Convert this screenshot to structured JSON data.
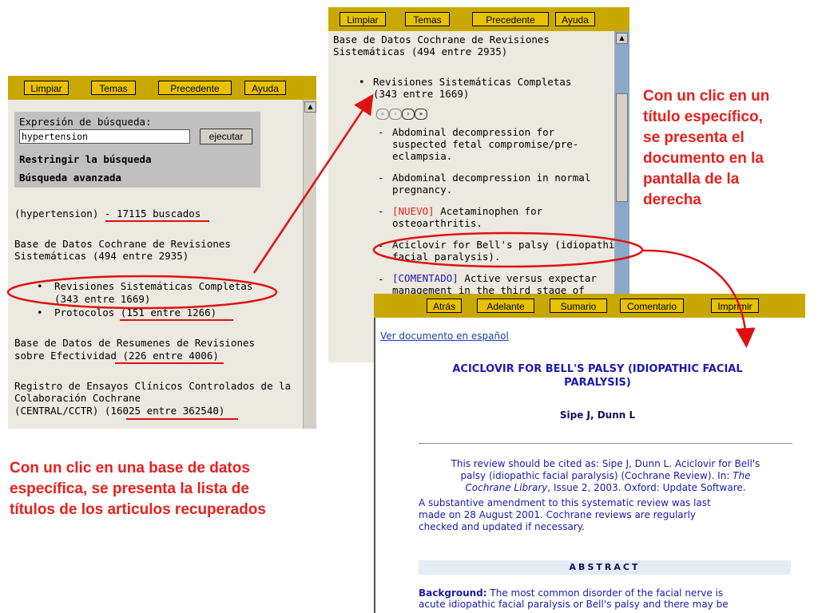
{
  "left_panel": {
    "toolbar": [
      "Limpiar",
      "Temas",
      "Precedente",
      "Ayuda"
    ],
    "search": {
      "label": "Expresión de búsqueda:",
      "value": "hypertension",
      "button": "ejecutar",
      "restrict": "Restringir la búsqueda",
      "advanced": "Búsqueda avanzada"
    },
    "query_term": "(hypertension)",
    "query_result": "- 17115 buscados",
    "db1_title_l1": "Base de Datos Cochrane de Revisiones",
    "db1_title_l2": "Sistemáticas (494 entre 2935)",
    "complete_label": "Revisiones Sistemáticas Completas",
    "complete_count": "(343 entre 1669)",
    "protocols_label": "Protocolos ",
    "protocols_count": "(151 entre 1266)",
    "db2_l1": "Base de Datos de Resumenes de Revisiones",
    "db2_l2a": "sobre Efectividad ",
    "db2_l2b": "(226 entre 4006)",
    "db3_l1": "Registro de Ensayos Clínicos Controlados de la",
    "db3_l2": "Colaboración Cochrane",
    "db3_l3a": "(CENTRAL/CCTR) (",
    "db3_l3b": "16025 entre 362540",
    "db3_l3c": ")"
  },
  "middle_panel": {
    "toolbar": [
      "Limpiar",
      "Temas",
      "Precedente",
      "Ayuda"
    ],
    "header_l1": "Base de Datos Cochrane de Revisiones",
    "header_l2": "Sistemáticas (494 entre 2935)",
    "complete_label": "Revisiones Sistemáticas Completas",
    "complete_count": "(343 entre 1669)",
    "items": [
      {
        "tag": "",
        "l1": "Abdominal decompression for",
        "l2": "suspected fetal compromise/pre-",
        "l3": "eclampsia."
      },
      {
        "tag": "",
        "l1": "Abdominal decompression in normal",
        "l2": "pregnancy.",
        "l3": ""
      },
      {
        "tag": "[NUEVO]",
        "l1": " Acetaminophen for",
        "l2": "osteoarthritis.",
        "l3": ""
      },
      {
        "tag": "",
        "l1": "Aciclovir for Bell's palsy (idiopathic",
        "l2": "facial paralysis).",
        "l3": ""
      },
      {
        "tag": "[COMENTADO]",
        "l1": " Active versus expectar",
        "l2": "management in the third stage of",
        "l3": ""
      }
    ]
  },
  "right_panel": {
    "toolbar": [
      "Atrás",
      "Adelante",
      "Sumario",
      "Comentario",
      "Imprimir"
    ],
    "spanish_link": "Ver documento en español",
    "title_l1": "ACICLOVIR FOR BELL'S PALSY (IDIOPATHIC FACIAL",
    "title_l2": "PARALYSIS)",
    "authors": "Sipe J, Dunn L",
    "cite_l1": "This review should be cited as: Sipe J, Dunn L. Aciclovir for Bell's",
    "cite_l2a": "palsy (idiopathic facial paralysis) (Cochrane Review). In: ",
    "cite_l2b": "The",
    "cite_l3a": "Cochrane Library",
    "cite_l3b": ", Issue 2, 2003. Oxford: Update Software.",
    "amend_l1": "A substantive amendment to this systematic review was last",
    "amend_l2": "made on 28 August 2001. Cochrane reviews are regularly",
    "amend_l3": "checked and updated if necessary.",
    "abstract": "ABSTRACT",
    "bg_label": "Background:",
    "bg_l1": " The most common disorder of the facial nerve is",
    "bg_l2": "acute idiopathic facial paralysis or Bell's palsy and there may be"
  },
  "callouts": {
    "right": [
      "Con un clic en un",
      "título específico,",
      "se presenta el",
      "documento en la",
      "pantalla de la",
      "derecha"
    ],
    "bottom": [
      "Con un clic en una base de datos",
      "específica, se presenta la lista de",
      "títulos de los articulos recuperados"
    ]
  },
  "colors": {
    "toolbar": "#c8a800",
    "accent_red": "#e8201c",
    "link_blue": "#1a3fb0",
    "panel_bg": "#ece9e0"
  }
}
